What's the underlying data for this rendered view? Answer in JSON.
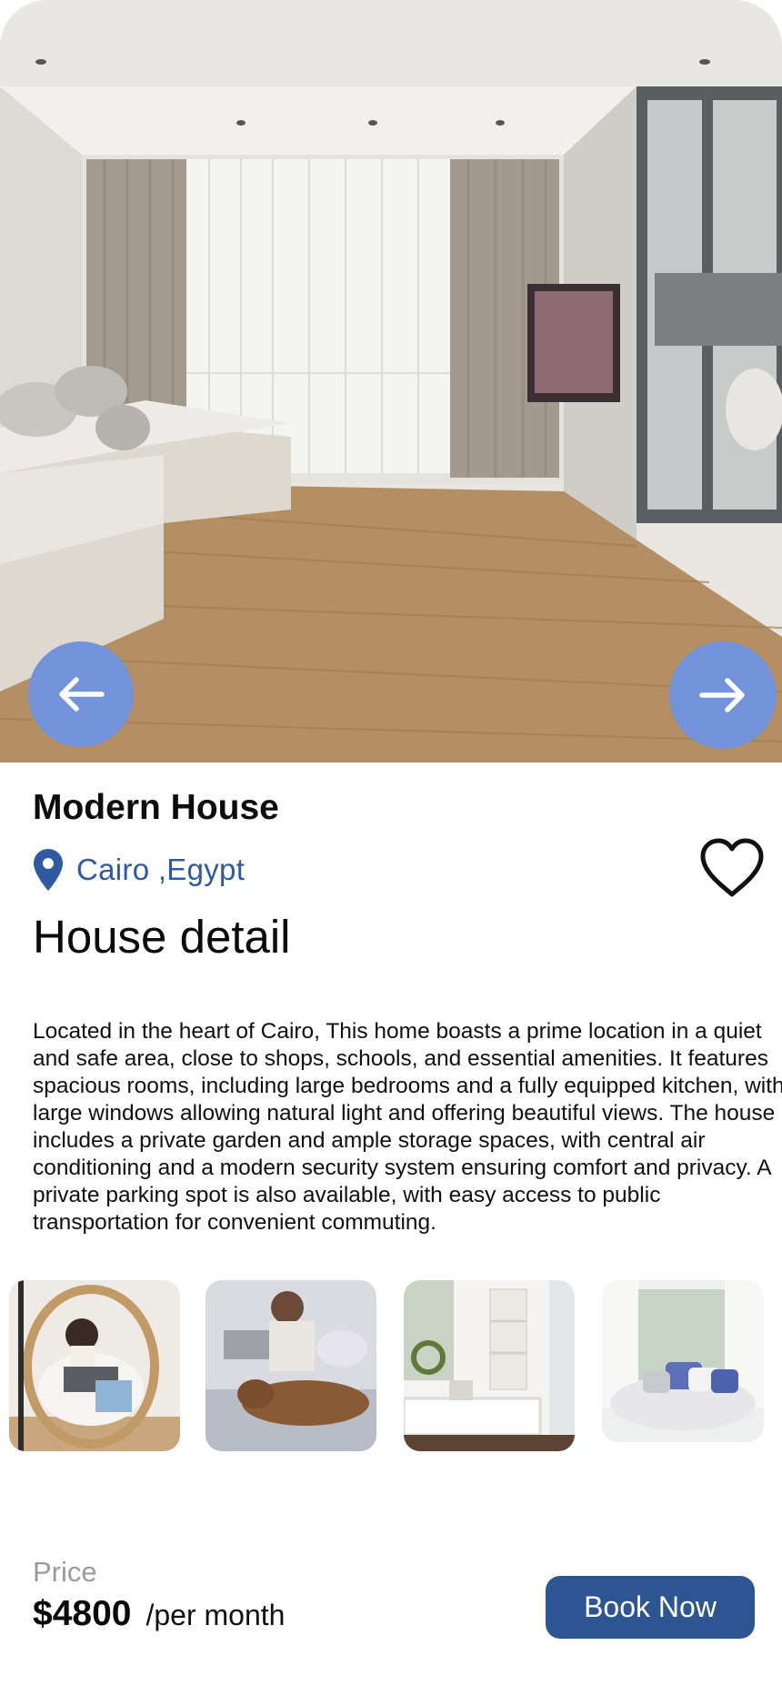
{
  "listing": {
    "title": "Modern House",
    "location": "Cairo ,Egypt",
    "section_title": "House detail",
    "description": "Located in the heart of Cairo, This home boasts a prime location in a quiet and safe area, close to shops, schools, and essential amenities. It features spacious rooms, including large bedrooms and a fully equipped kitchen, with large windows allowing natural light and offering beautiful views. The house includes a private garden and ample storage spaces, with central air conditioning and a modern security system ensuring comfort and privacy. A private parking spot is also available, with easy access to public transportation for convenient commuting."
  },
  "gallery": {
    "prev_icon": "arrow-left-icon",
    "next_icon": "arrow-right-icon",
    "thumbnails": [
      "woman-in-egg-chair-with-laptop",
      "woman-on-bed-with-dog",
      "white-mudroom-shelves",
      "round-window-seat-with-pillows"
    ]
  },
  "price": {
    "label": "Price",
    "value": "$4800",
    "unit": "/per month"
  },
  "actions": {
    "book_label": "Book Now",
    "favorite_icon": "heart-icon"
  },
  "colors": {
    "accent": "#2d5592",
    "location_text": "#2d5aa0",
    "nav_button": "#7292d9"
  }
}
